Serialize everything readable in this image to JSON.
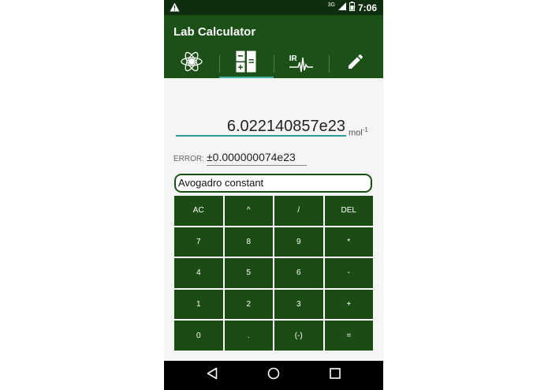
{
  "status_bar": {
    "network": "3G",
    "time": "7:06"
  },
  "app_bar": {
    "title": "Lab Calculator"
  },
  "tabs": [
    {
      "icon": "atom-icon",
      "active": false
    },
    {
      "icon": "calculator-icon",
      "active": true
    },
    {
      "icon": "ir-spectrum-icon",
      "label": "IR",
      "active": false
    },
    {
      "icon": "pencil-icon",
      "active": false
    }
  ],
  "calculator": {
    "value": "6.022140857e23",
    "unit": "mol",
    "unit_exponent": "-1",
    "error_label": "ERROR:",
    "error_value": "±0.000000074e23",
    "constant_name": "Avogadro constant"
  },
  "keypad": {
    "keys": [
      "AC",
      "^",
      "/",
      "DEL",
      "7",
      "8",
      "9",
      "*",
      "4",
      "5",
      "6",
      "-",
      "1",
      "2",
      "3",
      "+",
      "0",
      ".",
      "(-)",
      "="
    ]
  },
  "colors": {
    "app_bar": "#1b5016",
    "status_bar": "#0f2d0f",
    "key": "#1b4c13",
    "accent": "#2aa198"
  }
}
